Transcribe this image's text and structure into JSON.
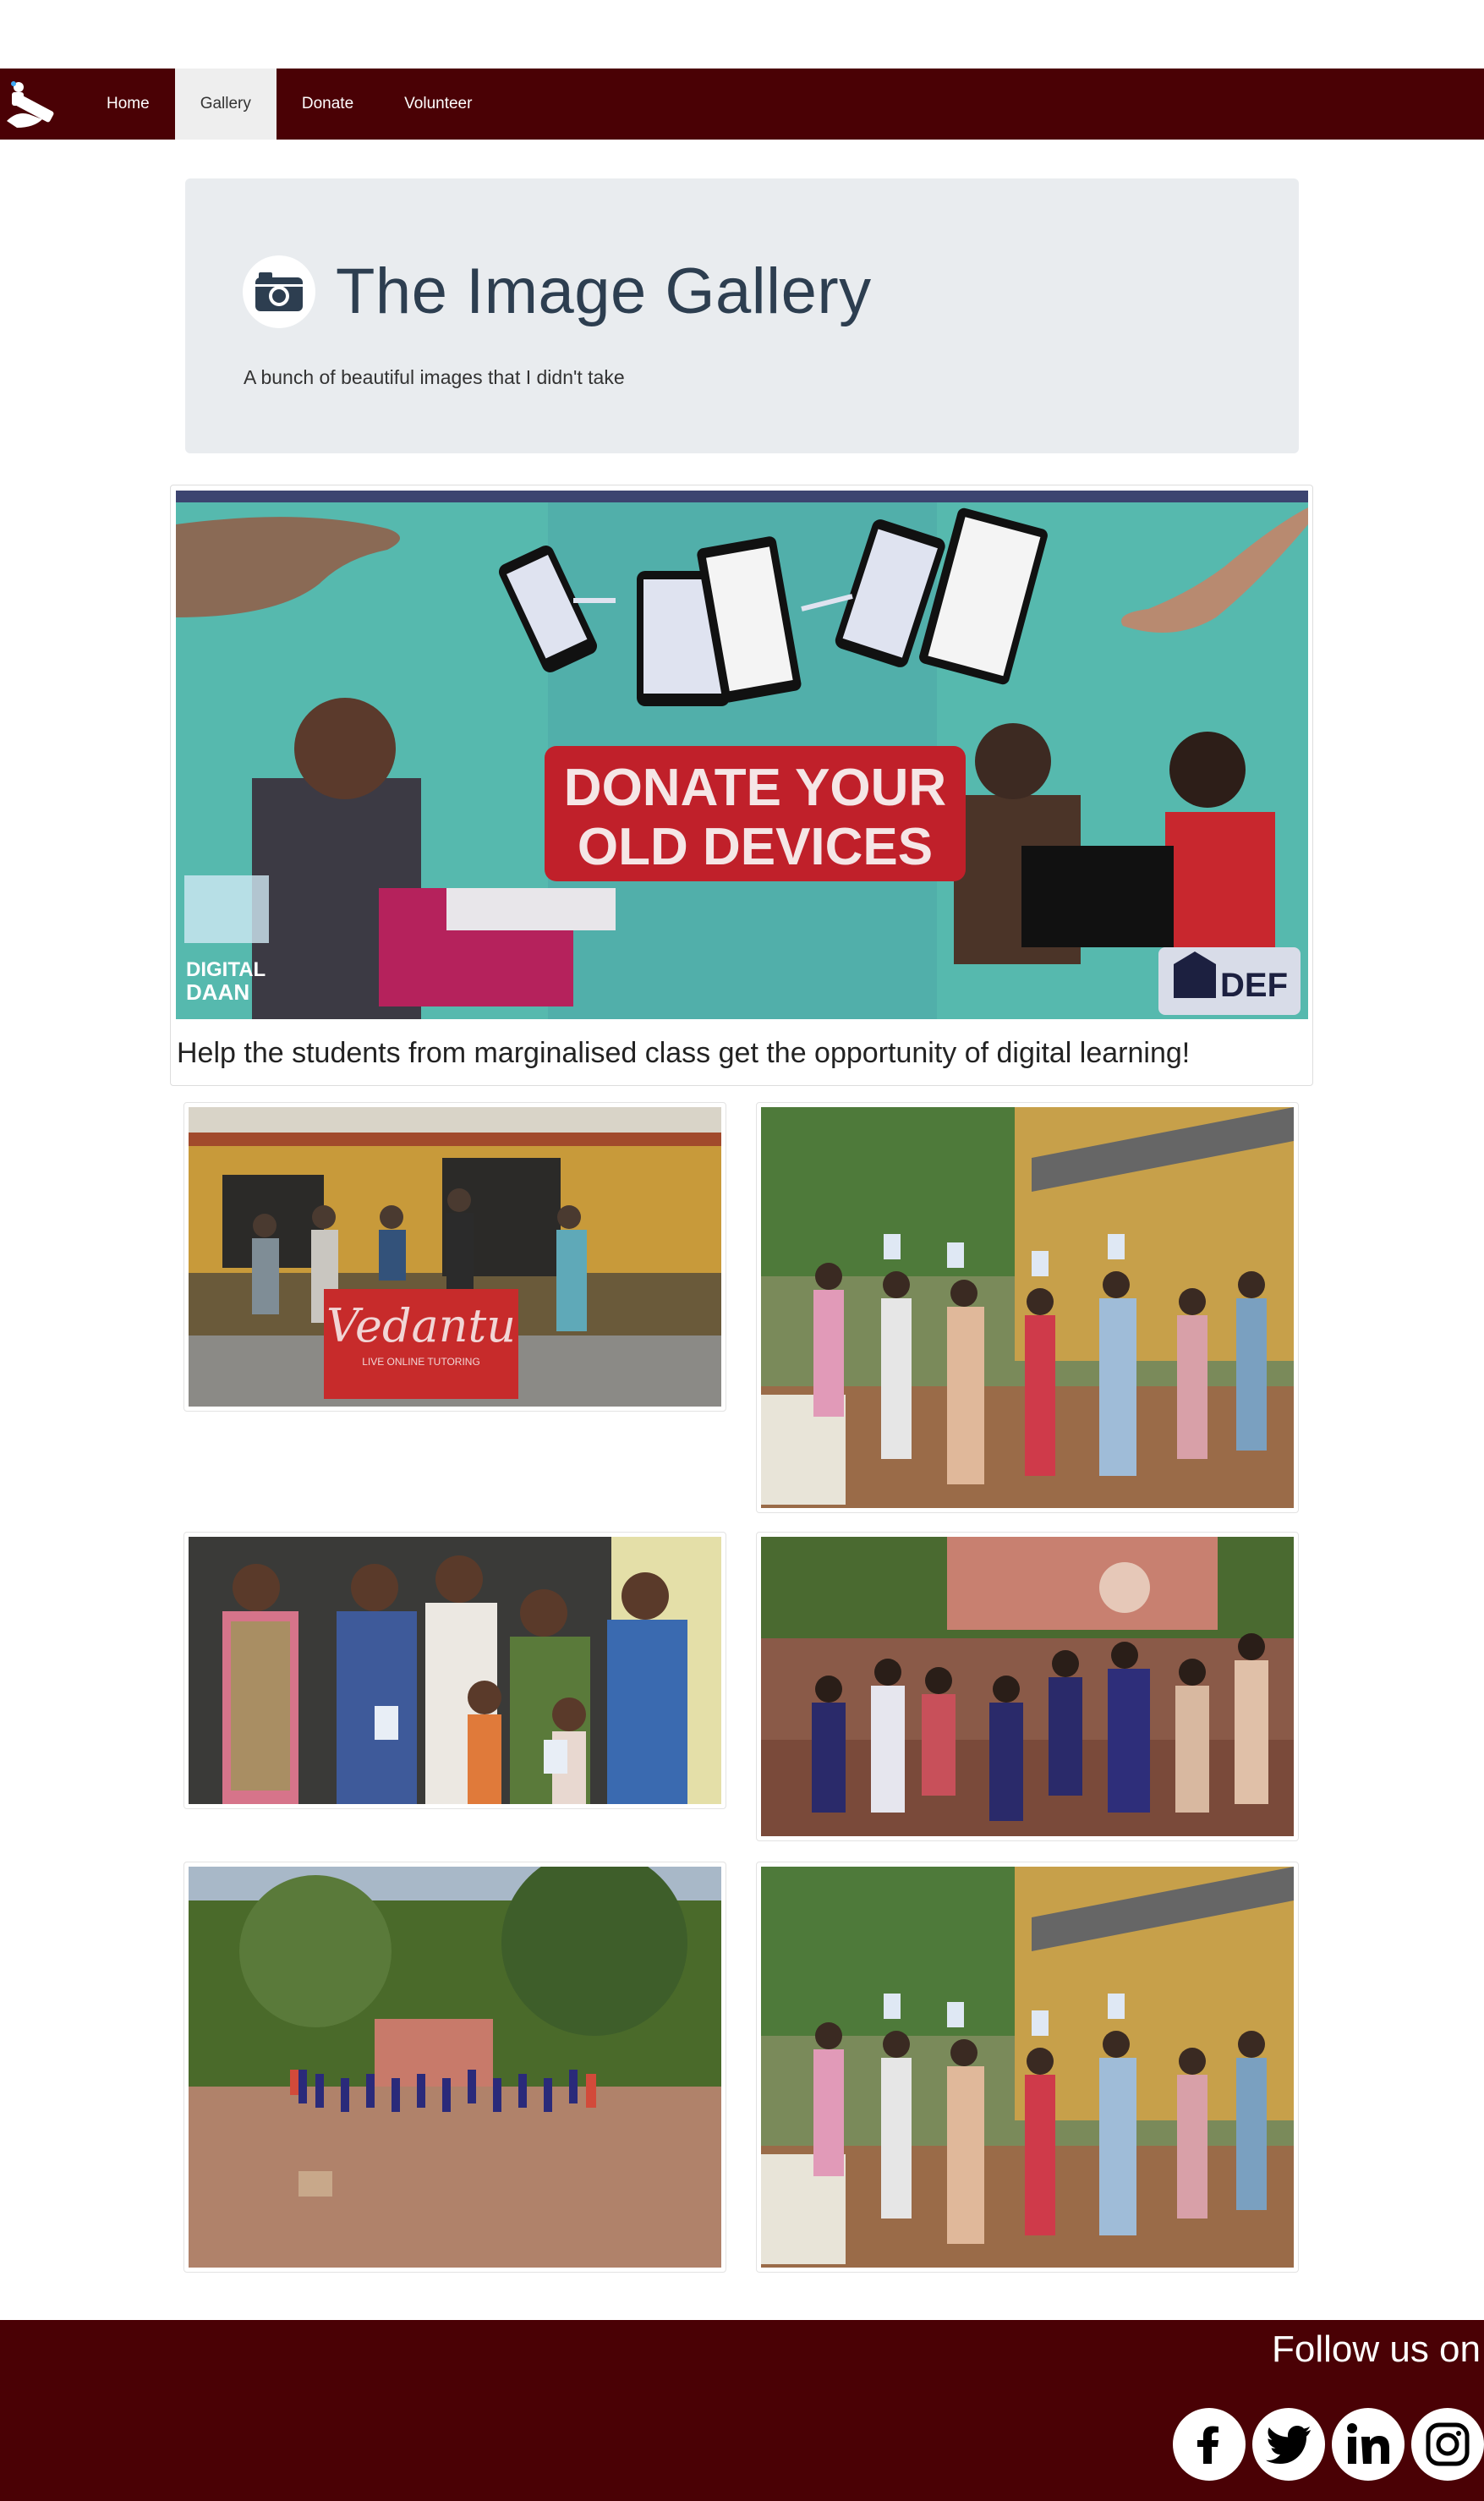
{
  "nav": {
    "brand_icon": "hand-tablet-logo-icon",
    "links": [
      {
        "label": "Home",
        "active": false
      },
      {
        "label": "Gallery",
        "active": true
      },
      {
        "label": "Donate",
        "active": false
      },
      {
        "label": "Volunteer",
        "active": false
      }
    ]
  },
  "jumbotron": {
    "icon": "camera-icon",
    "title": "The Image Gallery",
    "subtitle": "A bunch of beautiful images that I didn't take"
  },
  "featured": {
    "banner_text_line1": "DONATE YOUR",
    "banner_text_line2": "OLD DEVICES",
    "logo_left_line1": "DIGITAL",
    "logo_left_line2": "DAAN",
    "logo_right": "DEF",
    "caption": "Help the students from marginalised class get the opportunity of digital learning!"
  },
  "gallery": {
    "vedantu_sign": "Vedantu",
    "vedantu_tagline": "LIVE ONLINE TUTORING"
  },
  "footer": {
    "follow_text": "Follow us on",
    "socials": [
      "facebook-icon",
      "twitter-icon",
      "linkedin-icon",
      "instagram-icon"
    ]
  },
  "colors": {
    "brand": "#4a0105",
    "jumbotron_bg": "#e9ecef",
    "banner_red": "#c0202a",
    "banner_teal": "#55b8ae"
  }
}
